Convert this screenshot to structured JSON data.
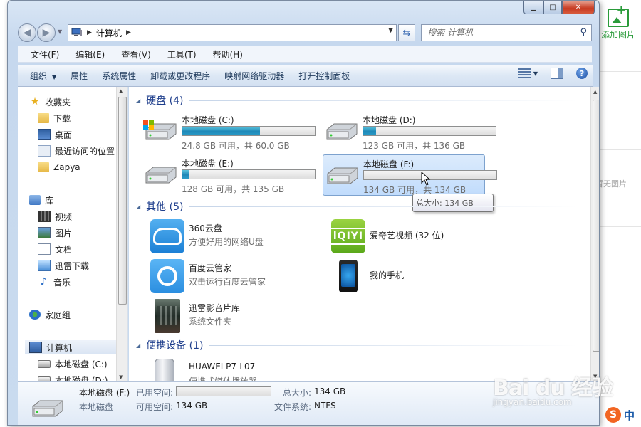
{
  "background": {
    "add_image_label": "添加图片",
    "no_image_label": "暂无图片"
  },
  "window": {
    "caption": {
      "minimize": "▁",
      "maximize": "□",
      "close": "✕"
    }
  },
  "address": {
    "crumb": "计算机",
    "search_placeholder": "搜索 计算机"
  },
  "menu": {
    "items": [
      "文件(F)",
      "编辑(E)",
      "查看(V)",
      "工具(T)",
      "帮助(H)"
    ]
  },
  "toolbar": {
    "organize": "组织",
    "properties": "属性",
    "system_properties": "系统属性",
    "uninstall": "卸载或更改程序",
    "map_drive": "映射网络驱动器",
    "control_panel": "打开控制面板"
  },
  "nav": {
    "favorites": "收藏夹",
    "downloads": "下载",
    "desktop": "桌面",
    "recent": "最近访问的位置",
    "zapya": "Zapya",
    "libraries": "库",
    "videos": "视频",
    "pictures": "图片",
    "documents": "文档",
    "thunder": "迅雷下载",
    "music": "音乐",
    "homegroup": "家庭组",
    "computer": "计算机",
    "disk_c": "本地磁盘 (C:)",
    "disk_d": "本地磁盘 (D:)"
  },
  "groups": {
    "hard_disks": "硬盘 (4)",
    "other": "其他 (5)",
    "portable": "便携设备 (1)"
  },
  "drives": [
    {
      "name": "本地磁盘 (C:)",
      "free_text": "24.8 GB 可用，共 60.0 GB",
      "used_fraction": 0.587
    },
    {
      "name": "本地磁盘 (D:)",
      "free_text": "123 GB 可用，共 136 GB",
      "used_fraction": 0.096
    },
    {
      "name": "本地磁盘 (E:)",
      "free_text": "128 GB 可用，共 135 GB",
      "used_fraction": 0.052
    },
    {
      "name": "本地磁盘 (F:)",
      "free_text": "134 GB 可用，共 134 GB",
      "used_fraction": 0.0
    }
  ],
  "tooltip": "总大小: 134 GB",
  "apps": {
    "a360_name": "360云盘",
    "a360_desc": "方便好用的网络U盘",
    "iqiyi_name": "爱奇艺视频 (32 位)",
    "iqiyi_icon_text": "iQIYI",
    "baidu_name": "百度云管家",
    "baidu_desc": "双击运行百度云管家",
    "phone_name": "我的手机",
    "movie_name": "迅雷影音片库",
    "movie_desc": "系统文件夹"
  },
  "device": {
    "name": "HUAWEI P7-L07",
    "desc": "便携式媒体播放器"
  },
  "details": {
    "title": "本地磁盘 (F:)",
    "type": "本地磁盘",
    "used_label": "已用空间:",
    "free_label": "可用空间:",
    "free_value": "134 GB",
    "total_label": "总大小:",
    "total_value": "134 GB",
    "fs_label": "文件系统:",
    "fs_value": "NTFS",
    "used_fraction": 0.0
  },
  "watermark": {
    "brand": "Bai du 经验",
    "url": "jingyan.baidu.com"
  },
  "ime": {
    "label": "中"
  }
}
